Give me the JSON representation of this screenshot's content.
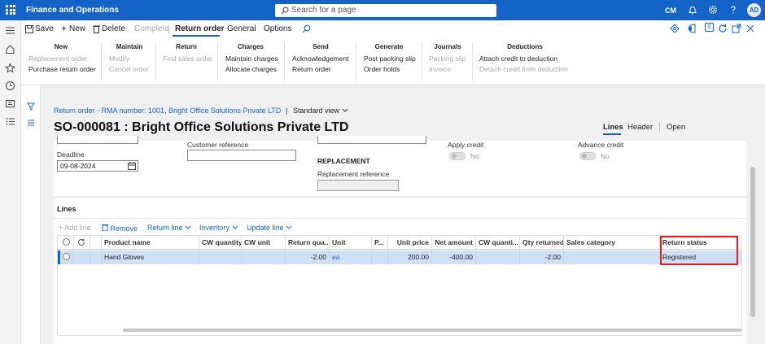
{
  "topbar": {
    "app_title": "Finance and Operations",
    "search_placeholder": "Search for a page",
    "company": "CM",
    "avatar_initials": "AD"
  },
  "menu": {
    "save": "Save",
    "new": "New",
    "delete": "Delete",
    "complete": "Complete",
    "tabs": [
      "Return order",
      "General",
      "Options"
    ],
    "badge": "0"
  },
  "groups": {
    "new": {
      "title": "New",
      "items": [
        "Replacement order",
        "Purchase return order"
      ]
    },
    "maintain": {
      "title": "Maintain",
      "items": [
        "Modify",
        "Cancel order"
      ]
    },
    "return": {
      "title": "Return",
      "items": [
        "Find sales order"
      ]
    },
    "charges": {
      "title": "Charges",
      "items": [
        "Maintain charges",
        "Allocate charges"
      ]
    },
    "send": {
      "title": "Send",
      "items": [
        "Acknowledgement",
        "Return order"
      ]
    },
    "generate": {
      "title": "Generate",
      "items": [
        "Post packing slip",
        "Order holds"
      ]
    },
    "journals": {
      "title": "Journals",
      "items": [
        "Packing slip",
        "Invoice"
      ]
    },
    "deductions": {
      "title": "Deductions",
      "items": [
        "Attach credit to deduction",
        "Detach credit from deduction"
      ]
    }
  },
  "page": {
    "breadcrumb": "Return order - RMA number: 1001, Bright Office Solutions Private LTD",
    "separator": "|",
    "view": "Standard view",
    "title": "SO-000081 : Bright Office Solutions Private LTD",
    "view_tabs": [
      "Lines",
      "Header",
      "Open"
    ]
  },
  "header_fields": {
    "deadline_label": "Deadline",
    "deadline_value": "09-08-2024",
    "customer_reference_label": "Customer reference",
    "customer_reference_value": "",
    "replacement_section": "REPLACEMENT",
    "replacement_reference_label": "Replacement reference",
    "apply_credit_label": "Apply credit",
    "apply_credit_value": "No",
    "advance_credit_label": "Advance credit",
    "advance_credit_value": "No"
  },
  "lines": {
    "title": "Lines",
    "toolbar": [
      "Add line",
      "Remove",
      "Return line",
      "Inventory",
      "Update line"
    ],
    "columns": [
      "Product name",
      "CW quantity",
      "CW unit",
      "Return qua...",
      "Unit",
      "P...",
      "Unit price",
      "Net amount",
      "CW quanti...",
      "Qty returned",
      "Sales category",
      "Return status"
    ],
    "rows": [
      {
        "product_name": "Hand Gloves",
        "cw_quantity": "",
        "cw_unit": "",
        "return_quantity": "-2.00",
        "unit": "ea",
        "p": "",
        "unit_price": "200.00",
        "net_amount": "-400.00",
        "cw_quantity_returned": "",
        "qty_returned": "-2.00",
        "sales_category": "",
        "return_status": "Registered"
      }
    ]
  },
  "colors": {
    "brand": "#1464c8",
    "selected_row": "#cfe0f5",
    "highlight_box": "#e02020"
  }
}
